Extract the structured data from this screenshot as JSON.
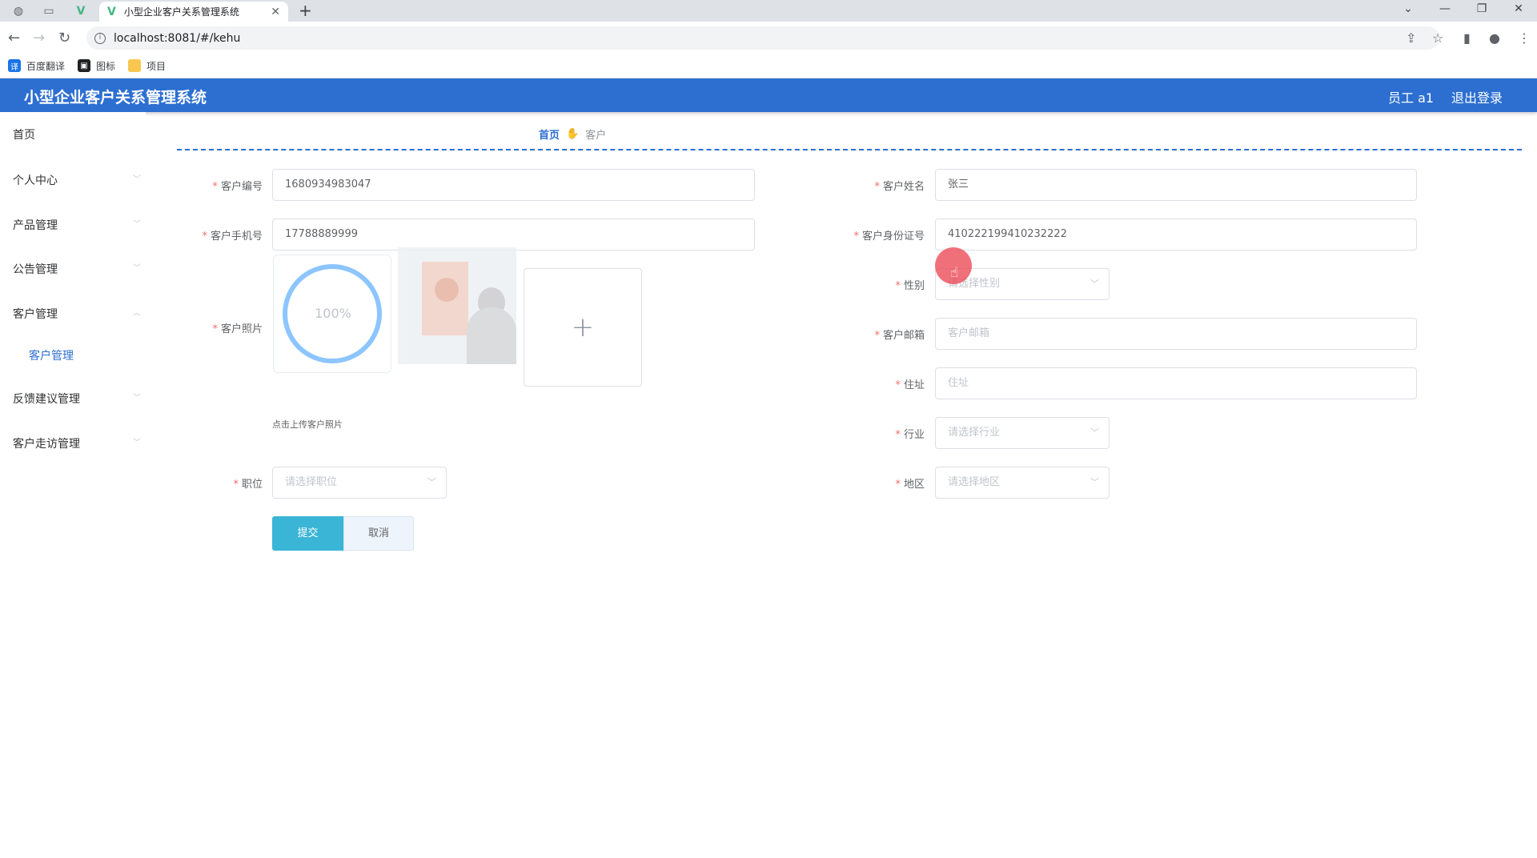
{
  "browser": {
    "active_tab_title": "小型企业客户关系管理系统",
    "url": "localhost:8081/#/kehu",
    "bookmarks": [
      {
        "label": "百度翻译",
        "icon": "translate-icon",
        "color": "#1a73e8"
      },
      {
        "label": "图标",
        "icon": "image-icon",
        "color": "#202124"
      },
      {
        "label": "项目",
        "icon": "folder-icon",
        "color": "#f9c74f"
      }
    ]
  },
  "header": {
    "title": "小型企业客户关系管理系统",
    "user": "员工 a1",
    "logout": "退出登录",
    "color": "#2c6fd1"
  },
  "sidebar": {
    "items": [
      {
        "label": "首页"
      },
      {
        "label": "个人中心"
      },
      {
        "label": "产品管理"
      },
      {
        "label": "公告管理"
      },
      {
        "label": "客户管理"
      },
      {
        "label": "反馈建议管理"
      },
      {
        "label": "客户走访管理"
      }
    ],
    "sub_item": "客户管理"
  },
  "breadcrumb": {
    "home": "首页",
    "separator": "✋",
    "current": "客户"
  },
  "form": {
    "customer_no": {
      "label": "客户编号",
      "value": "1680934983047"
    },
    "customer_name": {
      "label": "客户姓名",
      "value": "张三"
    },
    "phone": {
      "label": "客户手机号",
      "value": "17788889999"
    },
    "id_card": {
      "label": "客户身份证号",
      "value": "410222199410232222"
    },
    "photo": {
      "label": "客户照片",
      "progress": "100%",
      "tip": "点击上传客户照片",
      "add": "+"
    },
    "gender": {
      "label": "性别",
      "placeholder": "请选择性别"
    },
    "email": {
      "label": "客户邮箱",
      "placeholder": "客户邮箱"
    },
    "address": {
      "label": "住址",
      "placeholder": "住址"
    },
    "industry": {
      "label": "行业",
      "placeholder": "请选择行业"
    },
    "position": {
      "label": "职位",
      "placeholder": "请选择职位"
    },
    "region": {
      "label": "地区",
      "placeholder": "请选择地区"
    },
    "submit": "提交",
    "cancel": "取消",
    "required_mark": "*",
    "caret": "﹀"
  }
}
